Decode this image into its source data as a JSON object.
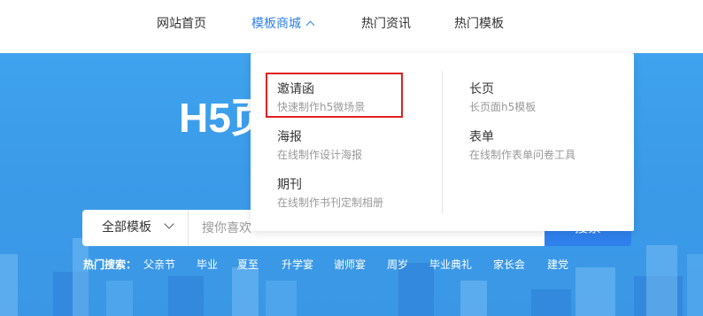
{
  "nav": {
    "items": [
      {
        "label": "网站首页"
      },
      {
        "label": "模板商城"
      },
      {
        "label": "热门资讯"
      },
      {
        "label": "热门模板"
      }
    ]
  },
  "dropdown": {
    "left_column": [
      {
        "title": "邀请函",
        "desc": "快速制作h5微场景"
      },
      {
        "title": "海报",
        "desc": "在线制作设计海报"
      },
      {
        "title": "期刊",
        "desc": "在线制作书刊定制相册"
      }
    ],
    "right_column": [
      {
        "title": "长页",
        "desc": "长页面h5模板"
      },
      {
        "title": "表单",
        "desc": "在线制作表单问卷工具"
      }
    ]
  },
  "hero": {
    "title": "H5页"
  },
  "search": {
    "category": "全部模板",
    "placeholder": "搜你喜欢",
    "button_label": "搜索"
  },
  "hot_search": {
    "label": "热门搜索：",
    "items": [
      "父亲节",
      "毕业",
      "夏至",
      "升学宴",
      "谢师宴",
      "周岁",
      "毕业典礼",
      "家长会",
      "建党"
    ]
  },
  "colors": {
    "accent": "#2f80ed",
    "hero_bg": "#3b9be9",
    "highlight_border": "#e02020"
  }
}
